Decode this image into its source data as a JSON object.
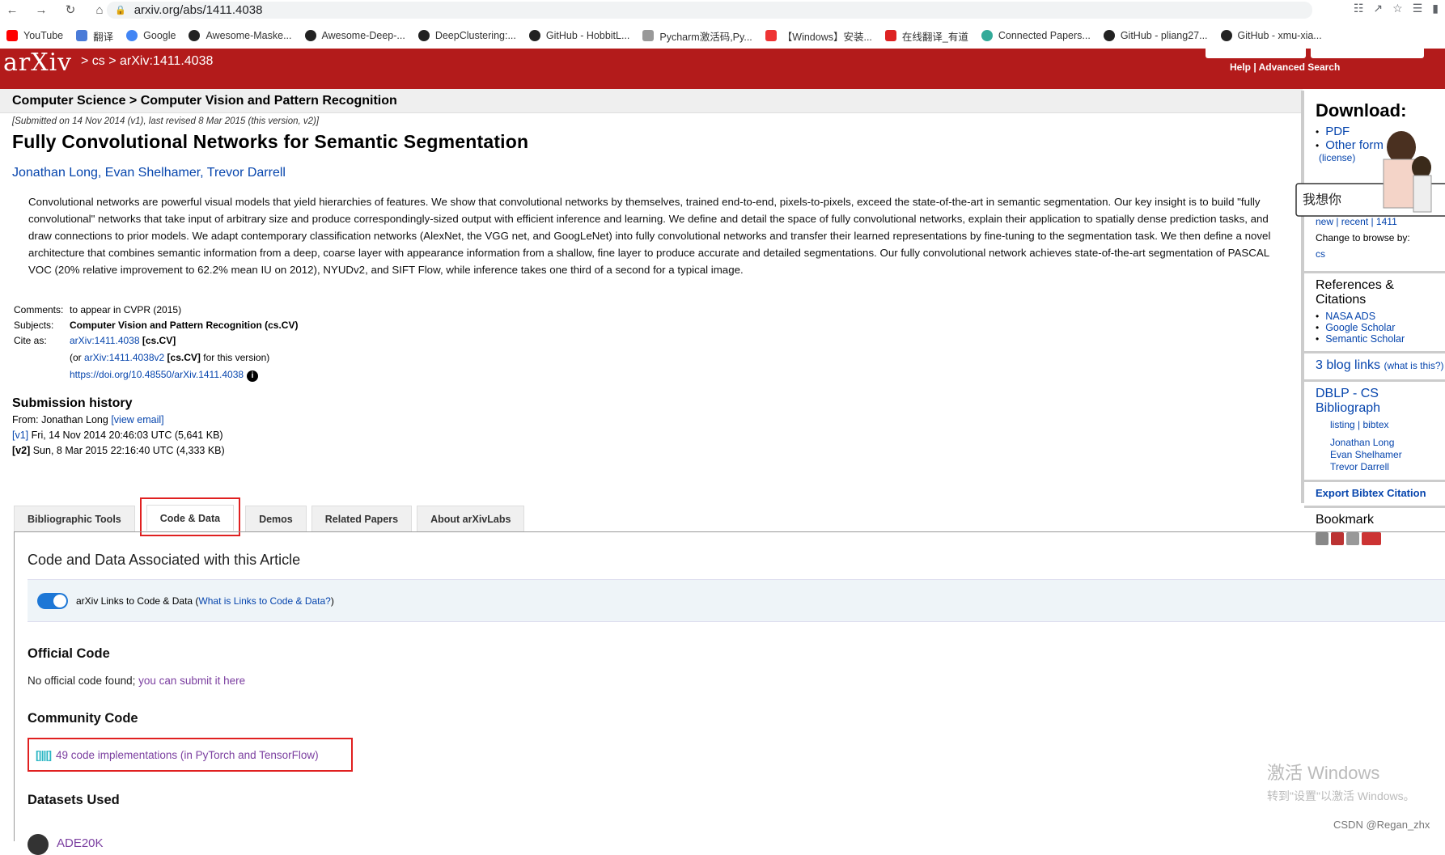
{
  "browser": {
    "url": "arxiv.org/abs/1411.4038",
    "bookmarks": [
      {
        "label": "YouTube",
        "color": "#ff0000"
      },
      {
        "label": "翻译",
        "color": "#4a7bd8"
      },
      {
        "label": "Google",
        "color": "#4285f4"
      },
      {
        "label": "Awesome-Maske...",
        "color": "#222"
      },
      {
        "label": "Awesome-Deep-...",
        "color": "#222"
      },
      {
        "label": "DeepClustering:...",
        "color": "#222"
      },
      {
        "label": "GitHub - HobbitL...",
        "color": "#222"
      },
      {
        "label": "Pycharm激活码,Py...",
        "color": "#999"
      },
      {
        "label": "【Windows】安装...",
        "color": "#e33"
      },
      {
        "label": "在线翻译_有道",
        "color": "#d22"
      },
      {
        "label": "Connected Papers...",
        "color": "#3a9"
      },
      {
        "label": "GitHub - pliang27...",
        "color": "#222"
      },
      {
        "label": "GitHub - xmu-xia...",
        "color": "#222"
      }
    ]
  },
  "header": {
    "logo": "arXiv",
    "breadcrumb": "> cs > arXiv:1411.4038",
    "help": "Help | Advanced Search"
  },
  "category_bar": "Computer Science > Computer Vision and Pattern Recognition",
  "paper": {
    "dateline": "[Submitted on 14 Nov 2014 (v1), last revised 8 Mar 2015 (this version, v2)]",
    "title": "Fully Convolutional Networks for Semantic Segmentation",
    "authors": "Jonathan Long, Evan Shelhamer, Trevor Darrell",
    "abstract": "Convolutional networks are powerful visual models that yield hierarchies of features. We show that convolutional networks by themselves, trained end-to-end, pixels-to-pixels, exceed the state-of-the-art in semantic segmentation. Our key insight is to build \"fully convolutional\" networks that take input of arbitrary size and produce correspondingly-sized output with efficient inference and learning. We define and detail the space of fully convolutional networks, explain their application to spatially dense prediction tasks, and draw connections to prior models. We adapt contemporary classification networks (AlexNet, the VGG net, and GoogLeNet) into fully convolutional networks and transfer their learned representations by fine-tuning to the segmentation task. We then define a novel architecture that combines semantic information from a deep, coarse layer with appearance information from a shallow, fine layer to produce accurate and detailed segmentations. Our fully convolutional network achieves state-of-the-art segmentation of PASCAL VOC (20% relative improvement to 62.2% mean IU on 2012), NYUDv2, and SIFT Flow, while inference takes one third of a second for a typical image.",
    "comments_label": "Comments:",
    "comments": "to appear in CVPR (2015)",
    "subjects_label": "Subjects:",
    "subjects": "Computer Vision and Pattern Recognition (cs.CV)",
    "cite_label": "Cite as:",
    "cite_id": "arXiv:1411.4038",
    "cite_cat": "[cs.CV]",
    "cite_v_pre": "(or",
    "cite_v_id": "arXiv:1411.4038v2",
    "cite_v_cat": "[cs.CV]",
    "cite_v_post": "for this version)",
    "doi": "https://doi.org/10.48550/arXiv.1411.4038"
  },
  "submission": {
    "heading": "Submission history",
    "from": "From: Jonathan Long",
    "view_email": "[view email]",
    "v1_tag": "[v1]",
    "v1": "Fri, 14 Nov 2014 20:46:03 UTC (5,641 KB)",
    "v2_tag": "[v2]",
    "v2": "Sun, 8 Mar 2015 22:16:40 UTC (4,333 KB)"
  },
  "tabs": [
    "Bibliographic Tools",
    "Code & Data",
    "Demos",
    "Related Papers",
    "About arXivLabs"
  ],
  "panel": {
    "title": "Code and Data Associated with this Article",
    "toggle_label": "arXiv Links to Code & Data",
    "toggle_link": "What is Links to Code & Data?",
    "toggle_on": true,
    "official_h": "Official Code",
    "official_text": "No official code found;",
    "official_link": "you can submit it here",
    "community_h": "Community Code",
    "community_link": "49 code implementations (in PyTorch and TensorFlow)",
    "datasets_h": "Datasets Used",
    "dataset1": "ADE20K"
  },
  "sidebar": {
    "download_h": "Download:",
    "pdf": "PDF",
    "other": "Other form",
    "license": "(license)",
    "nav": "new | recent | 1411",
    "browse": "Change to browse by:",
    "browse_cs": "cs",
    "refs_h": "References & Citations",
    "refs": [
      "NASA ADS",
      "Google Scholar",
      "Semantic Scholar"
    ],
    "blog_links": "3 blog links",
    "blog_what": "(what is this?)",
    "dblp": "DBLP - CS Bibliograph",
    "dblp_links": "listing | bibtex",
    "dblp_authors": [
      "Jonathan Long",
      "Evan Shelhamer",
      "Trevor Darrell"
    ],
    "export": "Export Bibtex Citation",
    "bookmark_h": "Bookmark"
  },
  "overlay": {
    "watermark_big": "激活 Windows",
    "watermark_small": "转到\"设置\"以激活 Windows。",
    "csdn": "CSDN @Regan_zhx"
  }
}
